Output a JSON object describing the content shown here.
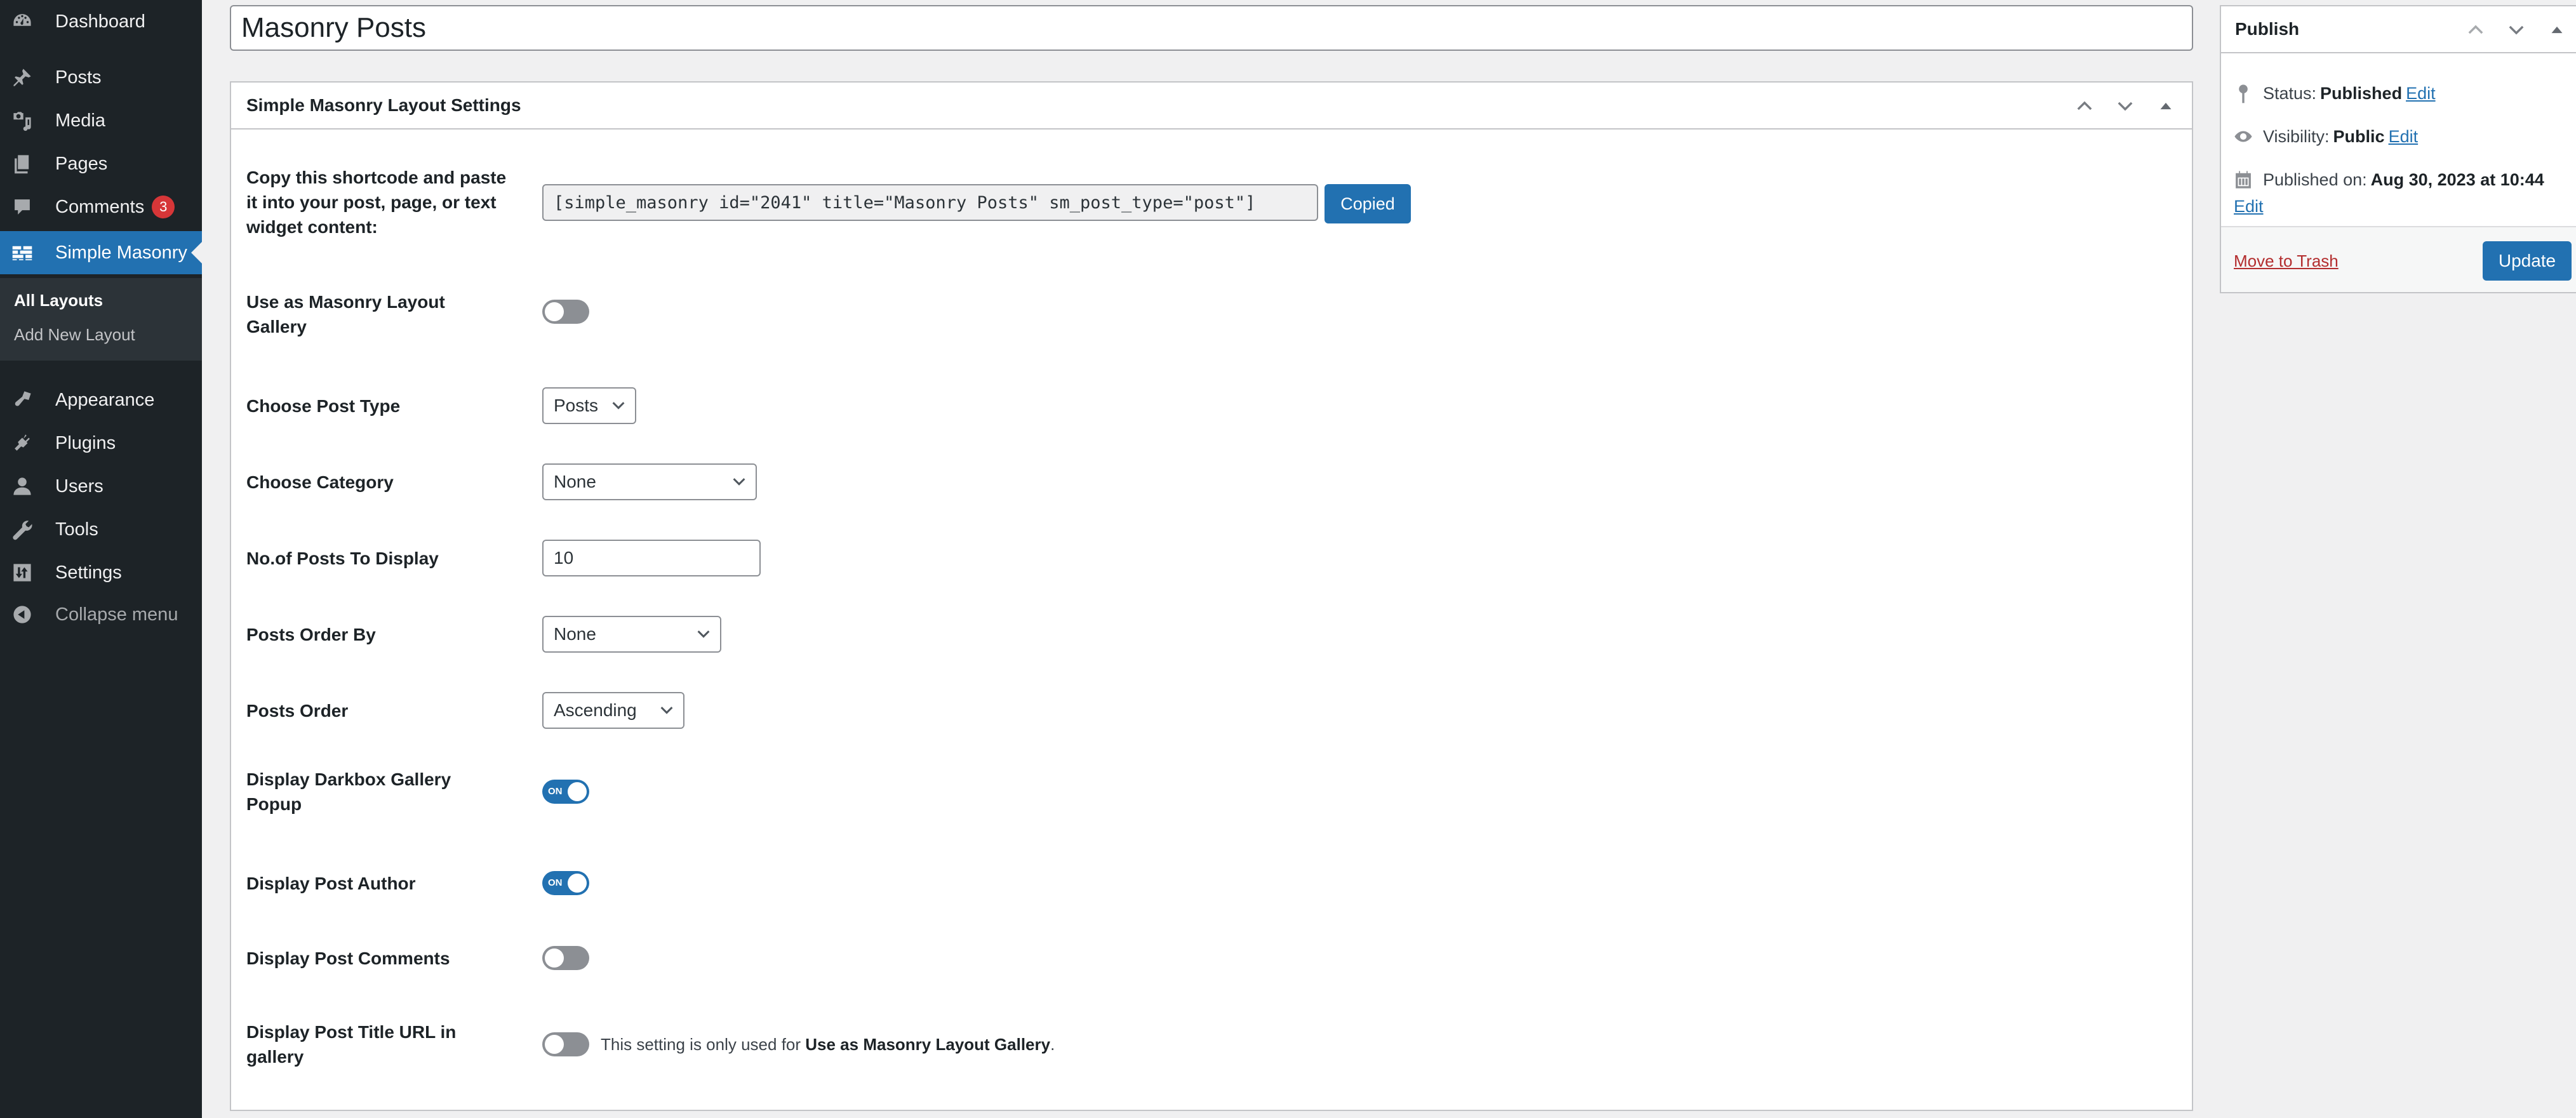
{
  "sidebar": {
    "items": [
      {
        "label": "Dashboard",
        "icon": "dashboard-icon"
      },
      {
        "label": "Posts",
        "icon": "pin-icon"
      },
      {
        "label": "Media",
        "icon": "media-icon"
      },
      {
        "label": "Pages",
        "icon": "pages-icon"
      },
      {
        "label": "Comments",
        "icon": "comment-icon",
        "badge": "3"
      },
      {
        "label": "Simple Masonry",
        "icon": "masonry-icon",
        "active": true
      },
      {
        "label": "Appearance",
        "icon": "paintbrush-icon"
      },
      {
        "label": "Plugins",
        "icon": "plugin-icon"
      },
      {
        "label": "Users",
        "icon": "user-icon"
      },
      {
        "label": "Tools",
        "icon": "wrench-icon"
      },
      {
        "label": "Settings",
        "icon": "settings-icon"
      },
      {
        "label": "Collapse menu",
        "icon": "collapse-icon"
      }
    ],
    "submenu": [
      {
        "label": "All Layouts",
        "current": true
      },
      {
        "label": "Add New Layout"
      }
    ]
  },
  "post": {
    "title": "Masonry Posts"
  },
  "settings_box": {
    "title": "Simple Masonry Layout Settings",
    "shortcode_label": "Copy this shortcode and paste it into your post, page, or text widget content:",
    "shortcode_value": "[simple_masonry id=\"2041\" title=\"Masonry Posts\" sm_post_type=\"post\"]",
    "copy_button": "Copied",
    "fields": {
      "use_gallery": {
        "label": "Use as Masonry Layout Gallery",
        "on": false
      },
      "post_type": {
        "label": "Choose Post Type",
        "value": "Posts"
      },
      "category": {
        "label": "Choose Category",
        "value": "None"
      },
      "posts_count": {
        "label": "No.of Posts To Display",
        "value": "10"
      },
      "order_by": {
        "label": "Posts Order By",
        "value": "None"
      },
      "order": {
        "label": "Posts Order",
        "value": "Ascending"
      },
      "darkbox": {
        "label": "Display Darkbox Gallery Popup",
        "on": true
      },
      "author": {
        "label": "Display Post Author",
        "on": true
      },
      "comments": {
        "label": "Display Post Comments",
        "on": false
      },
      "title_url": {
        "label": "Display Post Title URL in gallery",
        "on": false,
        "note_prefix": "This setting is only used for ",
        "note_bold": "Use as Masonry Layout Gallery",
        "note_suffix": "."
      }
    },
    "toggle_on_text": "ON"
  },
  "publish": {
    "title": "Publish",
    "status_label": "Status:",
    "status_value": "Published",
    "visibility_label": "Visibility:",
    "visibility_value": "Public",
    "published_label": "Published on:",
    "published_value": "Aug 30, 2023 at 10:44",
    "edit_link": "Edit",
    "trash_link": "Move to Trash",
    "update_button": "Update"
  },
  "colors": {
    "accent": "#2271b1",
    "sidebar_bg": "#1d2327",
    "badge": "#d63638",
    "trash": "#b32d2e"
  }
}
